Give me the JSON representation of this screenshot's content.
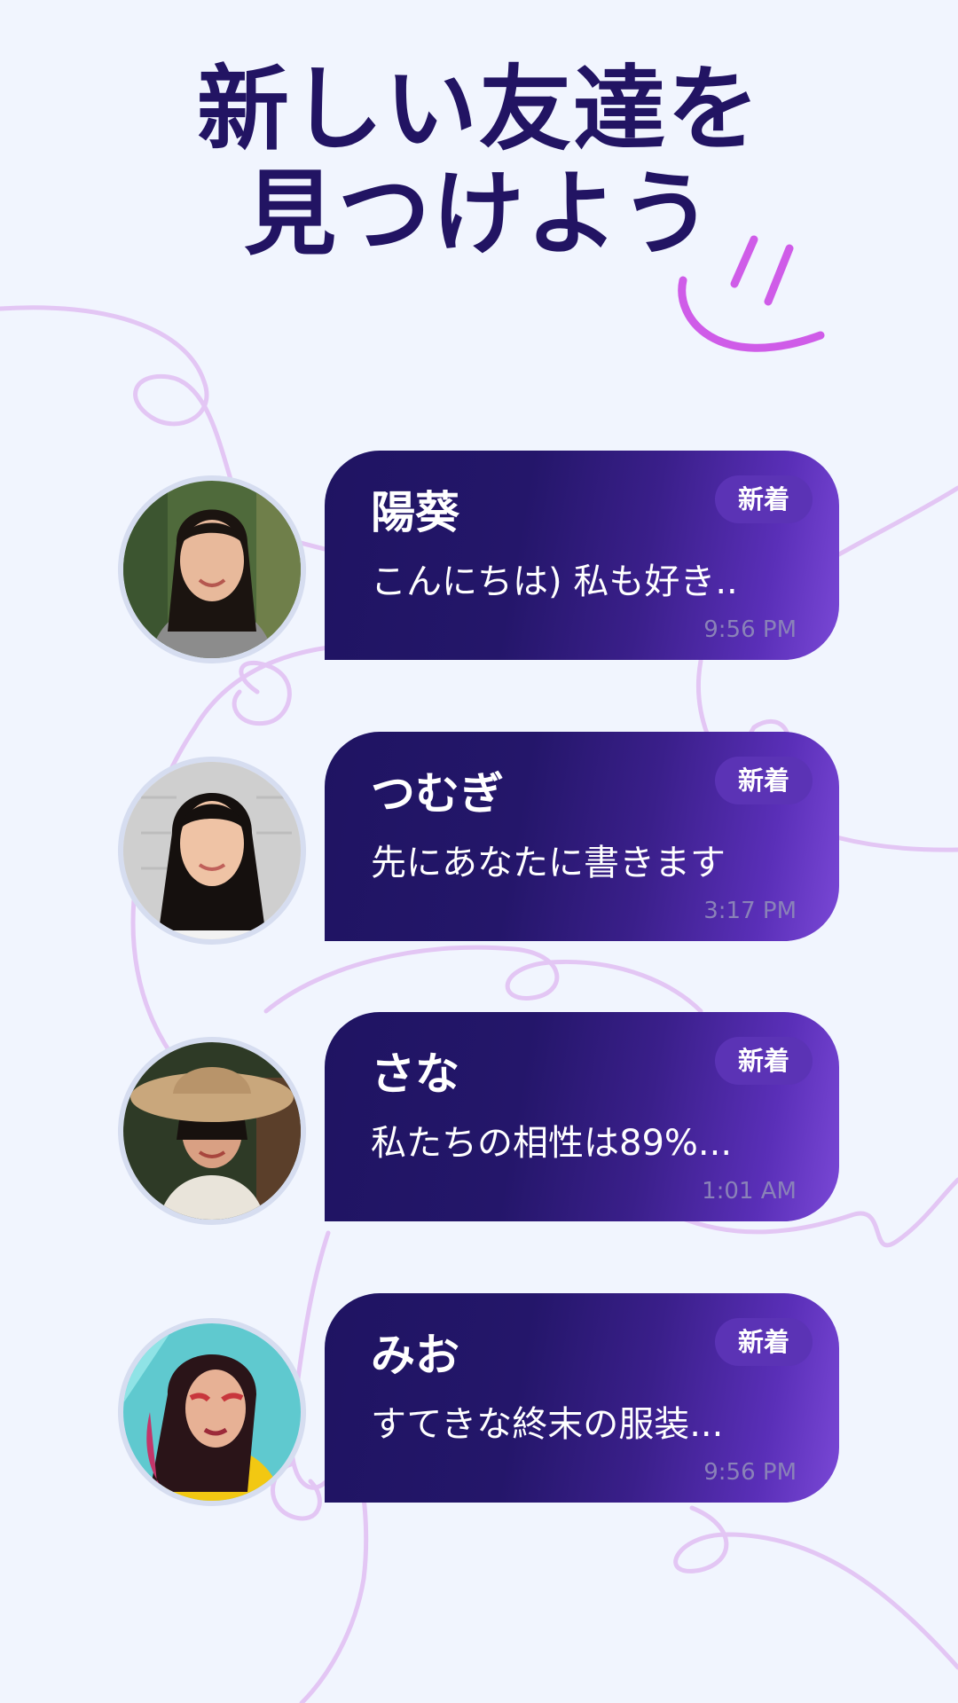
{
  "headline": {
    "line1": "新しい友達を",
    "line2": "見つけよう"
  },
  "colors": {
    "background": "#f1f5fe",
    "headline": "#221463",
    "bubble_start": "#1f1462",
    "bubble_end": "#7a48d6",
    "badge": "#5b33b5",
    "timestamp": "#8a82b8",
    "squiggle": "#e3c6f4",
    "smile": "#cf5ce8"
  },
  "decoration": {
    "smile_icon": "smiley-doodle-icon"
  },
  "chats": [
    {
      "name": "陽葵",
      "message": "こんにちは) 私も好き..",
      "time": "9:56 PM",
      "badge": "新着",
      "avatar_icon": "woman-avatar-1"
    },
    {
      "name": "つむぎ",
      "message": "先にあなたに書きます",
      "time": "3:17 PM",
      "badge": "新着",
      "avatar_icon": "woman-avatar-2"
    },
    {
      "name": "さな",
      "message": "私たちの相性は89%...",
      "time": "1:01 AM",
      "badge": "新着",
      "avatar_icon": "woman-avatar-3"
    },
    {
      "name": "みお",
      "message": "すてきな終末の服装...",
      "time": "9:56 PM",
      "badge": "新着",
      "avatar_icon": "woman-avatar-4"
    }
  ]
}
